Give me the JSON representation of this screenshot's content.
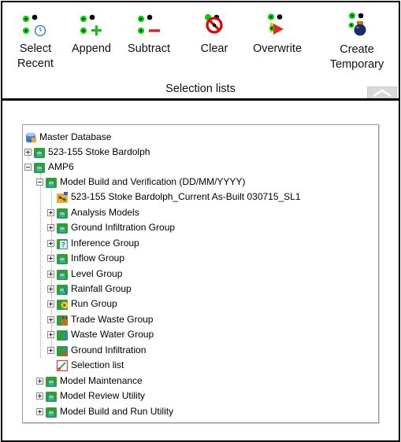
{
  "ribbon": {
    "group_title": "Selection lists",
    "buttons": [
      {
        "label": "Select\nRecent",
        "icon": "select-recent-icon"
      },
      {
        "label": "Append",
        "icon": "append-icon"
      },
      {
        "label": "Subtract",
        "icon": "subtract-icon"
      },
      {
        "label": "Clear",
        "icon": "clear-icon"
      },
      {
        "label": "Overwrite",
        "icon": "overwrite-icon"
      },
      {
        "label": "Create\nTemporary",
        "icon": "create-temporary-icon"
      }
    ],
    "colors": {
      "dot_green": "#00d000",
      "dot_black": "#000000",
      "plus_green": "#2bb52b",
      "minus_red": "#e0201c",
      "clear_red": "#e00000",
      "overwrite_yellow": "#f5c400"
    }
  },
  "tree": {
    "items": [
      {
        "label": "Master Database",
        "icon": "database-icon",
        "expander": "none"
      },
      {
        "label": "523-155 Stoke Bardolph",
        "icon": "network-group-icon",
        "expander": "plus"
      },
      {
        "label": "AMP6",
        "icon": "network-group-icon",
        "expander": "minus"
      },
      {
        "label": "Model Build and Verification (DD/MM/YYYY)",
        "icon": "network-group-icon",
        "expander": "minus"
      },
      {
        "label": "523-155 Stoke Bardolph_Current As-Built 030715_SL1",
        "icon": "network-model-icon",
        "expander": "none"
      },
      {
        "label": "Analysis Models",
        "icon": "network-group-icon",
        "expander": "plus"
      },
      {
        "label": "Ground Infiltration Group",
        "icon": "network-group-icon",
        "expander": "plus"
      },
      {
        "label": "Inference Group",
        "icon": "inference-group-icon",
        "expander": "plus"
      },
      {
        "label": "Inflow Group",
        "icon": "network-group-icon",
        "expander": "plus"
      },
      {
        "label": "Level Group",
        "icon": "network-group-icon",
        "expander": "plus"
      },
      {
        "label": "Rainfall Group",
        "icon": "rainfall-group-icon",
        "expander": "plus"
      },
      {
        "label": "Run Group",
        "icon": "run-group-icon",
        "expander": "plus"
      },
      {
        "label": "Trade Waste Group",
        "icon": "trade-waste-group-icon",
        "expander": "plus"
      },
      {
        "label": "Waste Water Group",
        "icon": "waste-water-group-icon",
        "expander": "plus"
      },
      {
        "label": "Ground Infiltration",
        "icon": "ground-infiltration-icon",
        "expander": "plus"
      },
      {
        "label": "Selection list",
        "icon": "selection-list-icon",
        "expander": "none"
      },
      {
        "label": "Model Maintenance",
        "icon": "network-group-icon",
        "expander": "plus"
      },
      {
        "label": "Model Review Utility",
        "icon": "network-group-icon",
        "expander": "plus"
      },
      {
        "label": "Model Build and Run Utility",
        "icon": "network-group-icon",
        "expander": "plus"
      }
    ]
  }
}
